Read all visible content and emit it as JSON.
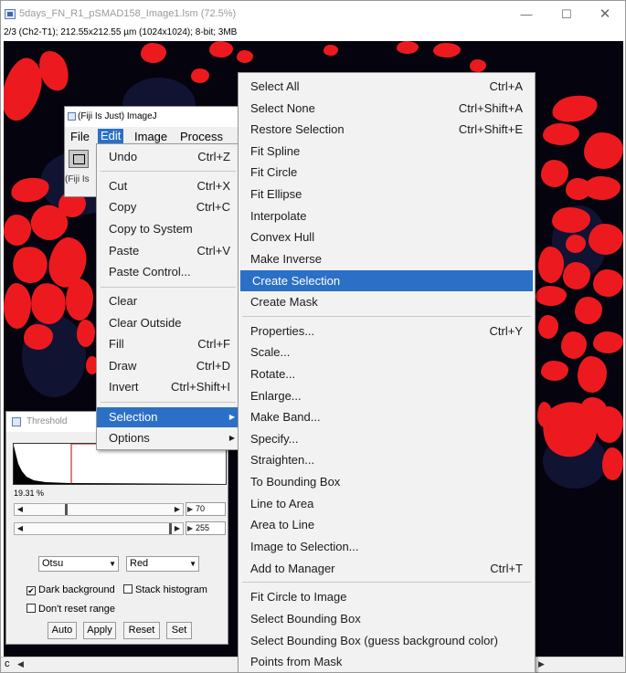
{
  "window": {
    "title": "5days_FN_R1_pSMAD158_Image1.lsm (72.5%)",
    "info": "2/3 (Ch2-T1); 212.55x212.55 µm (1024x1024); 8-bit; 3MB",
    "controls": {
      "minimize": "—",
      "maximize": "☐",
      "close": "✕"
    },
    "channel_label": "c"
  },
  "imagej": {
    "title": "(Fiji Is Just) ImageJ",
    "menus": [
      "File",
      "Edit",
      "Image",
      "Process"
    ],
    "active_menu": "Edit",
    "status": "(Fiji Is"
  },
  "edit_menu": {
    "items": [
      {
        "label": "Undo",
        "shortcut": "Ctrl+Z"
      },
      {
        "label": "Cut",
        "shortcut": "Ctrl+X"
      },
      {
        "label": "Copy",
        "shortcut": "Ctrl+C"
      },
      {
        "label": "Copy to System",
        "shortcut": ""
      },
      {
        "label": "Paste",
        "shortcut": "Ctrl+V"
      },
      {
        "label": "Paste Control...",
        "shortcut": ""
      },
      {
        "label": "Clear",
        "shortcut": ""
      },
      {
        "label": "Clear Outside",
        "shortcut": ""
      },
      {
        "label": "Fill",
        "shortcut": "Ctrl+F"
      },
      {
        "label": "Draw",
        "shortcut": "Ctrl+D"
      },
      {
        "label": "Invert",
        "shortcut": "Ctrl+Shift+I"
      },
      {
        "label": "Selection",
        "shortcut": ""
      },
      {
        "label": "Options",
        "shortcut": ""
      }
    ],
    "highlighted": "Selection"
  },
  "selection_menu": {
    "items": [
      {
        "label": "Select All",
        "shortcut": "Ctrl+A"
      },
      {
        "label": "Select None",
        "shortcut": "Ctrl+Shift+A"
      },
      {
        "label": "Restore Selection",
        "shortcut": "Ctrl+Shift+E"
      },
      {
        "label": "Fit Spline",
        "shortcut": ""
      },
      {
        "label": "Fit Circle",
        "shortcut": ""
      },
      {
        "label": "Fit Ellipse",
        "shortcut": ""
      },
      {
        "label": "Interpolate",
        "shortcut": ""
      },
      {
        "label": "Convex Hull",
        "shortcut": ""
      },
      {
        "label": "Make Inverse",
        "shortcut": ""
      },
      {
        "label": "Create Selection",
        "shortcut": ""
      },
      {
        "label": "Create Mask",
        "shortcut": ""
      },
      {
        "label": "Properties...",
        "shortcut": "Ctrl+Y"
      },
      {
        "label": "Scale...",
        "shortcut": ""
      },
      {
        "label": "Rotate...",
        "shortcut": ""
      },
      {
        "label": "Enlarge...",
        "shortcut": ""
      },
      {
        "label": "Make Band...",
        "shortcut": ""
      },
      {
        "label": "Specify...",
        "shortcut": ""
      },
      {
        "label": "Straighten...",
        "shortcut": ""
      },
      {
        "label": "To Bounding Box",
        "shortcut": ""
      },
      {
        "label": "Line to Area",
        "shortcut": ""
      },
      {
        "label": "Area to Line",
        "shortcut": ""
      },
      {
        "label": "Image to Selection...",
        "shortcut": ""
      },
      {
        "label": "Add to Manager",
        "shortcut": "Ctrl+T"
      },
      {
        "label": "Fit Circle to Image",
        "shortcut": ""
      },
      {
        "label": "Select Bounding Box",
        "shortcut": ""
      },
      {
        "label": "Select Bounding Box (guess background color)",
        "shortcut": ""
      },
      {
        "label": "Points from Mask",
        "shortcut": ""
      }
    ],
    "highlighted": "Create Selection"
  },
  "threshold": {
    "title": "Threshold",
    "percent": "19.31 %",
    "min_value": "70",
    "max_value": "255",
    "min_level": 0.27,
    "max_level": 1.0,
    "method": "Otsu",
    "display": "Red",
    "dark_background": {
      "label": "Dark background",
      "checked": true
    },
    "stack_histogram": {
      "label": "Stack histogram",
      "checked": false
    },
    "dont_reset_range": {
      "label": "Don't reset range",
      "checked": false
    },
    "buttons": [
      "Auto",
      "Apply",
      "Reset",
      "Set"
    ]
  },
  "colors": {
    "accent": "#2b70c6",
    "nuclei": "#ec1a1f",
    "background": "#04030e"
  }
}
